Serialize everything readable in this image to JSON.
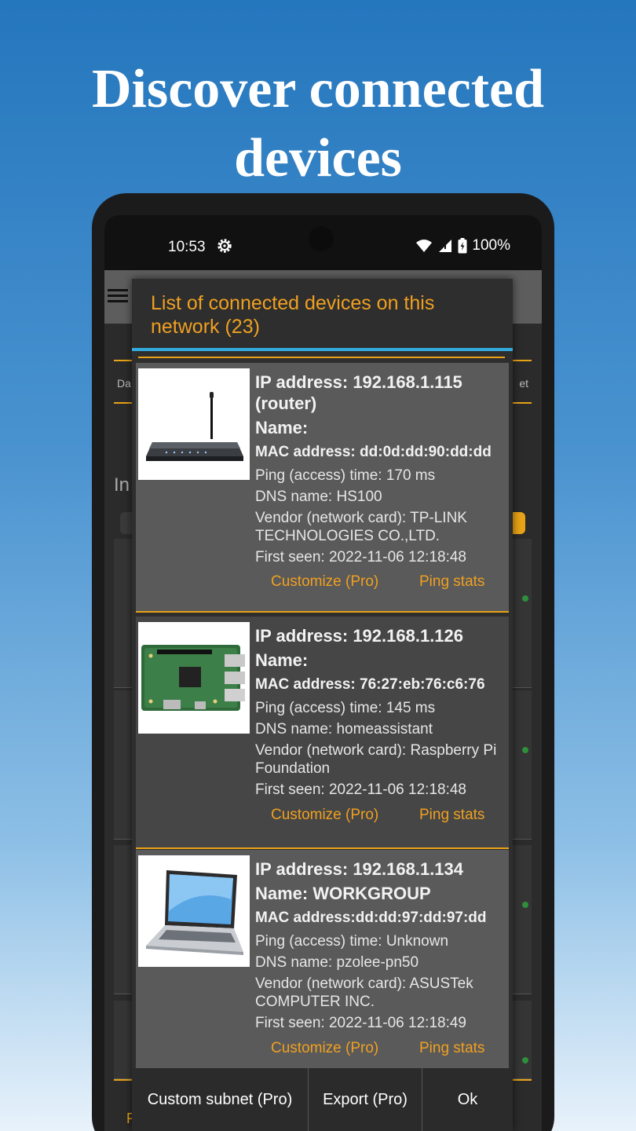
{
  "headline": {
    "line1": "Discover connected",
    "line2": "devices"
  },
  "statusbar": {
    "time": "10:53",
    "battery": "100%"
  },
  "dialog": {
    "title": "List of connected devices on this network (23)",
    "devices": [
      {
        "ip": "IP address: 192.168.1.115 (router)",
        "name": "Name:",
        "mac": "MAC address: dd:0d:dd:90:dd:dd",
        "ping": "Ping (access) time: 170 ms",
        "dns": "DNS name: HS100",
        "vendor": "Vendor (network card): TP-LINK TECHNOLOGIES CO.,LTD.",
        "first_seen": "First seen: 2022-11-06 12:18:48",
        "icon": "router-image"
      },
      {
        "ip": "IP address: 192.168.1.126",
        "name": "Name:",
        "mac": "MAC address: 76:27:eb:76:c6:76",
        "ping": "Ping (access) time: 145 ms",
        "dns": "DNS name: homeassistant",
        "vendor": "Vendor (network card): Raspberry Pi Foundation",
        "first_seen": "First seen: 2022-11-06 12:18:48",
        "icon": "raspberry-pi-image"
      },
      {
        "ip": "IP address: 192.168.1.134",
        "name": "Name: WORKGROUP",
        "mac": "MAC address:dd:dd:97:dd:97:dd",
        "ping": "Ping (access) time: Unknown",
        "dns": "DNS name: pzolee-pn50",
        "vendor": "Vendor (network card): ASUSTek COMPUTER INC.",
        "first_seen": "First seen: 2022-11-06 12:18:49",
        "icon": "laptop-image"
      }
    ],
    "actions": {
      "customize": "Customize (Pro)",
      "ping_stats": "Ping stats"
    },
    "buttons": {
      "custom_subnet": "Custom subnet (Pro)",
      "export": "Export (Pro)",
      "ok": "Ok"
    }
  },
  "background": {
    "tab_left": "Da",
    "tab_right": "et",
    "section": "In",
    "footer": "F"
  },
  "colors": {
    "accent": "#f0a020",
    "rule": "#33aadd",
    "headline": "#ffffff"
  }
}
